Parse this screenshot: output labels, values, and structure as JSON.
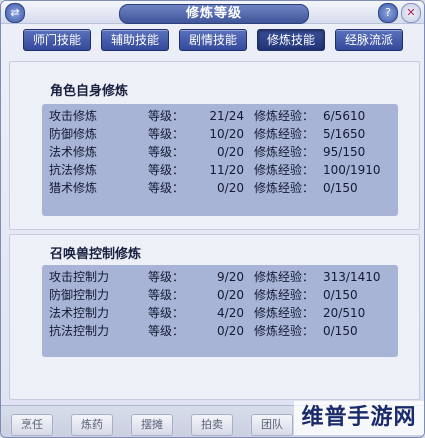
{
  "window": {
    "title": "修炼等级",
    "help_glyph": "?",
    "close_glyph": "✕",
    "swap_glyph": "⇄"
  },
  "tabs": [
    {
      "label": "师门技能",
      "active": false
    },
    {
      "label": "辅助技能",
      "active": false
    },
    {
      "label": "剧情技能",
      "active": false
    },
    {
      "label": "修炼技能",
      "active": true
    },
    {
      "label": "经脉流派",
      "active": false
    }
  ],
  "character": {
    "title": "角色自身修炼",
    "level_label": "等级：",
    "exp_label": "修炼经验：",
    "rows": [
      {
        "name": "攻击修炼",
        "level": "21/24",
        "exp": "6/5610"
      },
      {
        "name": "防御修炼",
        "level": "10/20",
        "exp": "5/1650"
      },
      {
        "name": "法术修炼",
        "level": "0/20",
        "exp": "95/150"
      },
      {
        "name": "抗法修炼",
        "level": "11/20",
        "exp": "100/1910"
      },
      {
        "name": "猎术修炼",
        "level": "0/20",
        "exp": "0/150"
      }
    ]
  },
  "pet": {
    "title": "召唤兽控制修炼",
    "level_label": "等级：",
    "exp_label": "修炼经验：",
    "rows": [
      {
        "name": "攻击控制力",
        "level": "9/20",
        "exp": "313/1410"
      },
      {
        "name": "防御控制力",
        "level": "0/20",
        "exp": "0/150"
      },
      {
        "name": "法术控制力",
        "level": "4/20",
        "exp": "20/510"
      },
      {
        "name": "抗法控制力",
        "level": "0/20",
        "exp": "0/150"
      }
    ]
  },
  "bottom_bar": [
    "烹任",
    "炼药",
    "摆摊",
    "拍卖",
    "团队"
  ],
  "watermark": "维普手游网",
  "colors": {
    "tab_blue": "#3f5499",
    "box_blue": "#a7b4d6",
    "text_dark": "#141a33"
  }
}
